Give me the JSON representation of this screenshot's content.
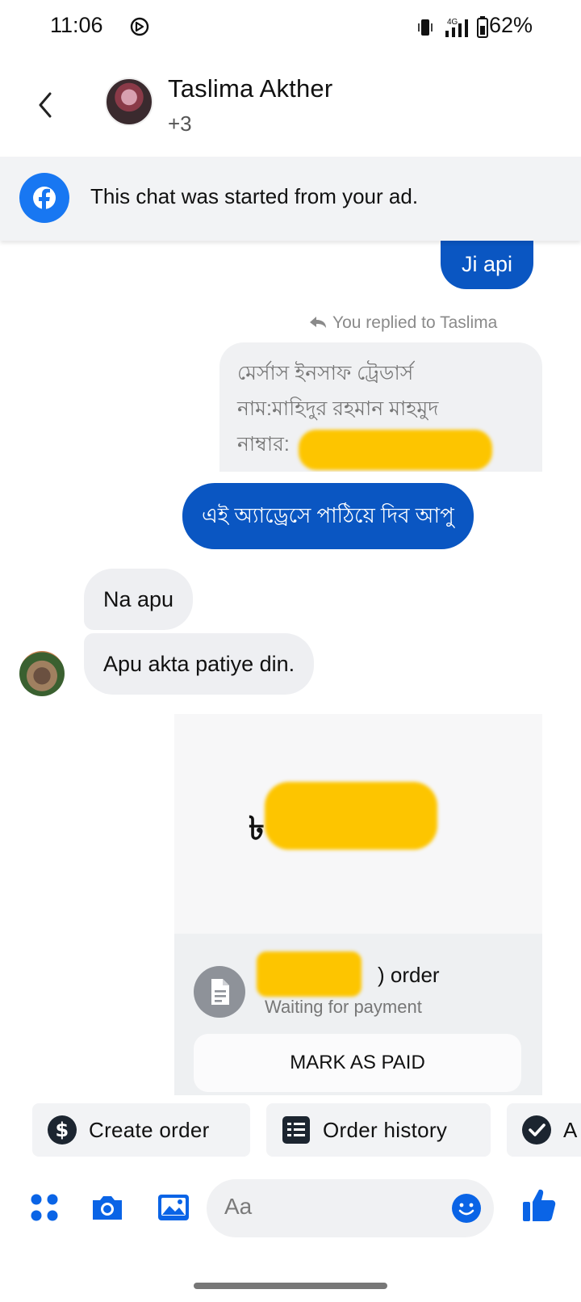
{
  "status_bar": {
    "time": "11:06",
    "battery": "62%",
    "network": "4G"
  },
  "header": {
    "contact_name": "Taslima Akther",
    "participants_extra": "+3"
  },
  "ad_banner": {
    "text": "This chat was started from your ad."
  },
  "messages": {
    "ji_api": "Ji api",
    "reply_note": "You replied to Taslima",
    "quoted_lines": [
      "মের্সাস ইনসাফ ট্রেডার্স",
      "নাম:মাহিদুর রহমান মাহমুদ",
      "নাম্বার:"
    ],
    "quoted_ellipsis": "...",
    "bangla_reply": "এই অ্যাড্রেসে পাঠিয়ে দিব আপু",
    "na_apu": "Na apu",
    "apu_akta": "Apu akta patiye din."
  },
  "order_card": {
    "currency_symbol": "৳",
    "title_suffix": ") order",
    "status": "Waiting for payment",
    "mark_paid_label": "MARK AS PAID"
  },
  "action_chips": {
    "create_order": "Create order",
    "order_history": "Order history",
    "third_partial": "A"
  },
  "composer": {
    "placeholder": "Aa"
  },
  "colors": {
    "outgoing_bubble": "#0a56c2",
    "incoming_bubble": "#eeeff2",
    "facebook_blue": "#1877f2",
    "redaction_yellow": "#fdc500"
  }
}
